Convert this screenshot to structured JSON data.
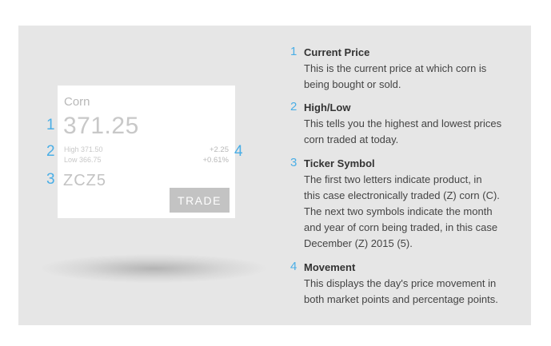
{
  "card": {
    "commodity": "Corn",
    "price": "371.25",
    "high": "High 371.50",
    "low": "Low 366.75",
    "change_points": "+2.25",
    "change_percent": "+0.61%",
    "ticker": "ZCZ5",
    "trade_label": "TRADE"
  },
  "callouts": [
    "1",
    "2",
    "3",
    "4"
  ],
  "colors": {
    "accent": "#4aaee6",
    "panel": "#e6e6e6",
    "button": "#c3c3c3"
  },
  "legend": [
    {
      "number": "1",
      "title": "Current Price",
      "lines": [
        "This is the current price at which corn is",
        "being bought or sold."
      ]
    },
    {
      "number": "2",
      "title": "High/Low",
      "lines": [
        "This tells you the highest and lowest prices",
        "corn traded at today."
      ]
    },
    {
      "number": "3",
      "title": "Ticker Symbol",
      "lines": [
        "The first two letters indicate product, in",
        "this case electronically traded (Z) corn (C).",
        "The next two symbols indicate the month",
        "and year of corn being traded, in this case",
        "December (Z) 2015 (5)."
      ]
    },
    {
      "number": "4",
      "title": "Movement",
      "lines": [
        "This displays the day's price movement in",
        "both market points and percentage points."
      ]
    }
  ]
}
